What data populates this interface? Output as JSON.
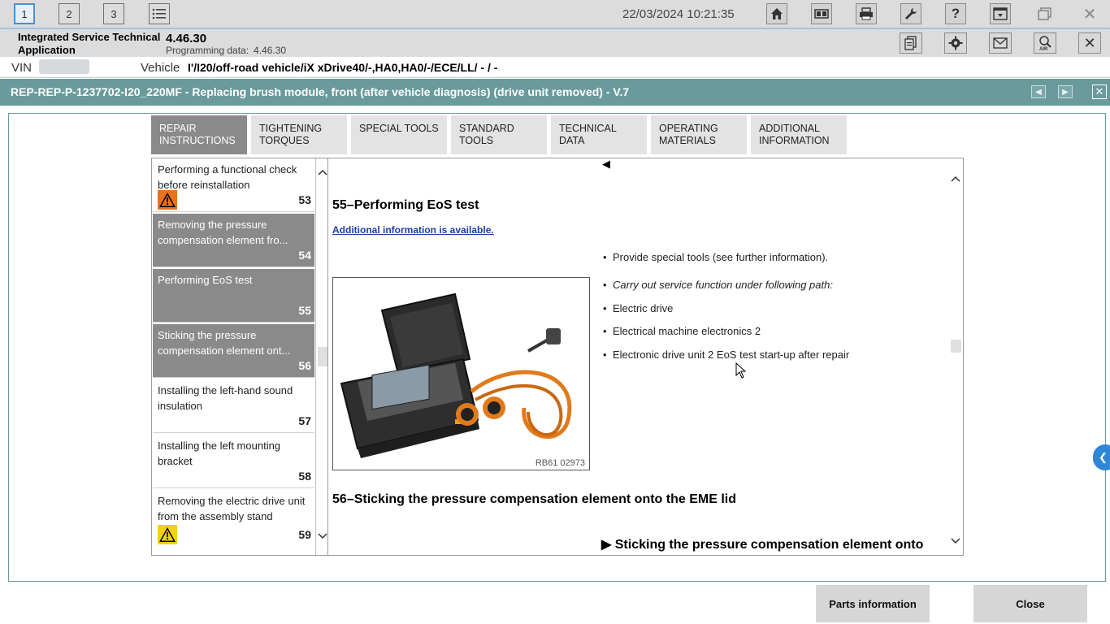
{
  "topbar": {
    "workspaces": [
      "1",
      "2",
      "3"
    ],
    "datetime": "22/03/2024 10:21:35"
  },
  "app": {
    "name": "Integrated Service Technical Application",
    "version": "4.46.30",
    "programming_label": "Programming data:",
    "programming_value": "4.46.30"
  },
  "vehicle": {
    "vin_label": "VIN",
    "vehicle_label": "Vehicle",
    "vehicle_value": "I'/I20/off-road vehicle/iX xDrive40/-,HA0,HA0/-/ECE/LL/ - / -"
  },
  "document": {
    "title": "REP-REP-P-1237702-I20_220MF - Replacing brush module, front (after vehicle diagnosis) (drive unit removed) - V.7"
  },
  "tabs": [
    {
      "label": "Repair instructions"
    },
    {
      "label": "Tightening torques"
    },
    {
      "label": "Special tools"
    },
    {
      "label": "Standard tools"
    },
    {
      "label": "Technical data"
    },
    {
      "label": "Operating materials"
    },
    {
      "label": "Additional information"
    }
  ],
  "steps": [
    {
      "title": "Performing a functional check before reinstallation",
      "num": "53"
    },
    {
      "title": "Removing the pressure compensation element fro...",
      "num": "54"
    },
    {
      "title": "Performing EoS test",
      "num": "55"
    },
    {
      "title": "Sticking the pressure compensation element ont...",
      "num": "56"
    },
    {
      "title": "Installing the left-hand sound insulation",
      "num": "57"
    },
    {
      "title": "Installing the left mounting bracket",
      "num": "58"
    },
    {
      "title": "Removing the electric drive unit from the assembly stand",
      "num": "59"
    }
  ],
  "content": {
    "heading_55": "55–Performing EoS test",
    "additional_link": "Additional information is available.",
    "image_caption": "RB61 02973",
    "bullets": [
      "Provide special tools (see further information).",
      "Carry out service function under following path:",
      "Electric drive",
      "Electrical machine electronics 2",
      "Electronic drive unit 2 EoS test start-up after repair"
    ],
    "heading_56": "56–Sticking the pressure compensation element onto the EME lid",
    "subheading_56": "▶ Sticking the pressure compensation element onto"
  },
  "buttons": {
    "parts_info": "Parts information",
    "close": "Close"
  },
  "icons": {
    "home": "home-icon",
    "settings": "gear-icon",
    "help": "help-icon"
  },
  "colors": {
    "title_bar": "#6a9a9b",
    "tab_active": "#8a8a8a",
    "warning_orange": "#e8731a",
    "warning_yellow": "#f2d20a",
    "link": "#1a3ea8"
  }
}
